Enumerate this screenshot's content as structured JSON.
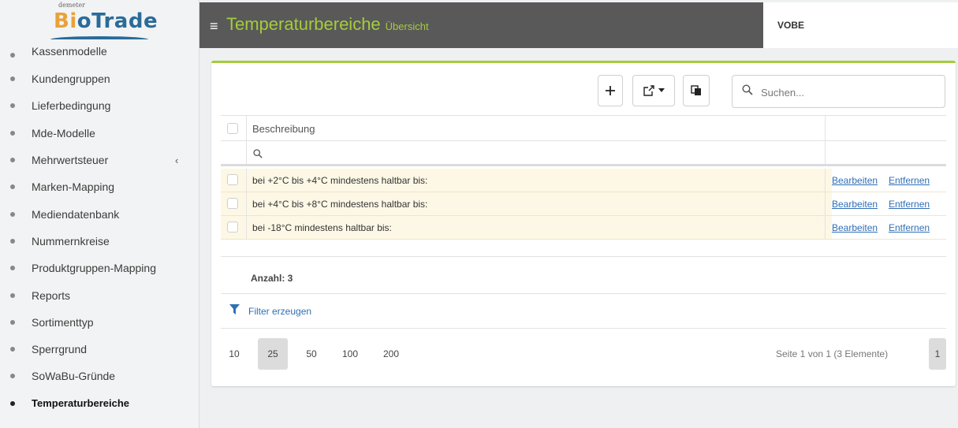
{
  "brand": {
    "small": "demeter",
    "main_bi": "Bi",
    "main_rest": "oTrade"
  },
  "sidebar": {
    "items": [
      {
        "label": "Kassenmodelle",
        "active": false
      },
      {
        "label": "Kundengruppen",
        "active": false
      },
      {
        "label": "Lieferbedingung",
        "active": false
      },
      {
        "label": "Mde-Modelle",
        "active": false
      },
      {
        "label": "Mehrwertsteuer",
        "active": false,
        "chevron": "‹"
      },
      {
        "label": "Marken-Mapping",
        "active": false
      },
      {
        "label": "Mediendatenbank",
        "active": false
      },
      {
        "label": "Nummernkreise",
        "active": false
      },
      {
        "label": "Produktgruppen-Mapping",
        "active": false
      },
      {
        "label": "Reports",
        "active": false
      },
      {
        "label": "Sortimenttyp",
        "active": false
      },
      {
        "label": "Sperrgrund",
        "active": false
      },
      {
        "label": "SoWaBu-Gründe",
        "active": false
      },
      {
        "label": "Temperaturbereiche",
        "active": true
      }
    ]
  },
  "header": {
    "title": "Temperaturbereiche",
    "subtitle": "Übersicht",
    "user": "VOBE"
  },
  "toolbar": {
    "search_placeholder": "Suchen..."
  },
  "table": {
    "column_header": "Beschreibung",
    "rows": [
      {
        "text": "bei +2°C bis +4°C mindestens haltbar bis:",
        "edit": "Bearbeiten",
        "remove": "Entfernen"
      },
      {
        "text": "bei +4°C bis +8°C mindestens haltbar bis:",
        "edit": "Bearbeiten",
        "remove": "Entfernen"
      },
      {
        "text": "bei -18°C mindestens haltbar bis:",
        "edit": "Bearbeiten",
        "remove": "Entfernen"
      }
    ]
  },
  "count": "Anzahl: 3",
  "filter_create": "Filter erzeugen",
  "pager": {
    "sizes": [
      "10",
      "25",
      "50",
      "100",
      "200"
    ],
    "active_size": "25",
    "info": "Seite 1 von 1 (3 Elemente)",
    "page": "1"
  },
  "colors": {
    "accent": "#a4cc3a",
    "topbar": "#595959",
    "link": "#2f6fb5",
    "row_highlight": "#fdf8e6"
  }
}
